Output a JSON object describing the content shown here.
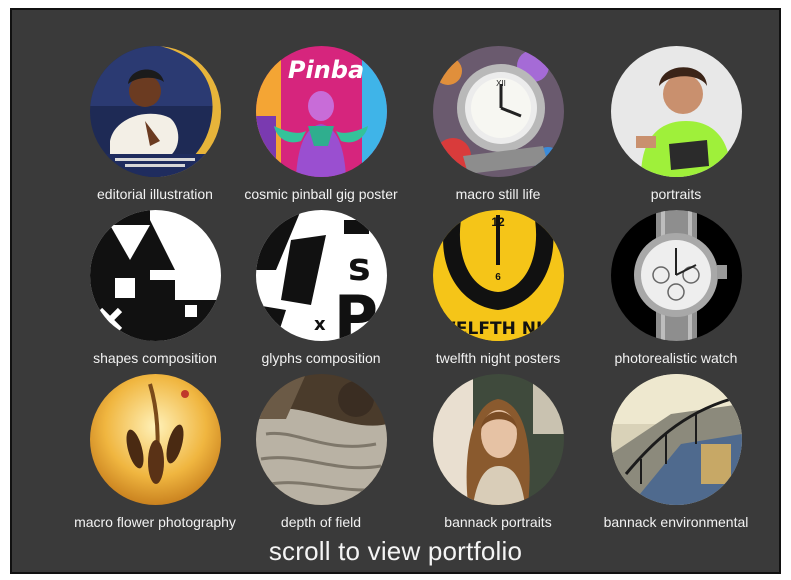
{
  "portfolio": {
    "items": [
      {
        "label": "editorial illustration",
        "icon": "editorial-illustration-thumbnail"
      },
      {
        "label": "cosmic pinball gig poster",
        "icon": "pinball-poster-thumbnail",
        "thumb_text": "Pinba"
      },
      {
        "label": "macro still life",
        "icon": "watch-macro-thumbnail"
      },
      {
        "label": "portraits",
        "icon": "portrait-thumbnail"
      },
      {
        "label": "shapes composition",
        "icon": "shapes-composition-thumbnail"
      },
      {
        "label": "glyphs composition",
        "icon": "glyphs-composition-thumbnail"
      },
      {
        "label": "twelfth night posters",
        "icon": "twelfth-night-thumbnail",
        "thumb_text": "TWELFTH NIGH",
        "thumb_number": "6",
        "thumb_number_top": "12"
      },
      {
        "label": "photorealistic watch",
        "icon": "photorealistic-watch-thumbnail"
      },
      {
        "label": "macro flower photography",
        "icon": "flower-macro-thumbnail"
      },
      {
        "label": "depth of field",
        "icon": "tree-bark-thumbnail"
      },
      {
        "label": "bannack portraits",
        "icon": "bannack-portrait-thumbnail"
      },
      {
        "label": "bannack environmental",
        "icon": "staircase-thumbnail"
      }
    ]
  },
  "cta": {
    "label": "scroll to view portfolio"
  },
  "colors": {
    "background": "#3a3a3a",
    "text": "#f2f2f2",
    "accent_yellow": "#f5c518"
  }
}
